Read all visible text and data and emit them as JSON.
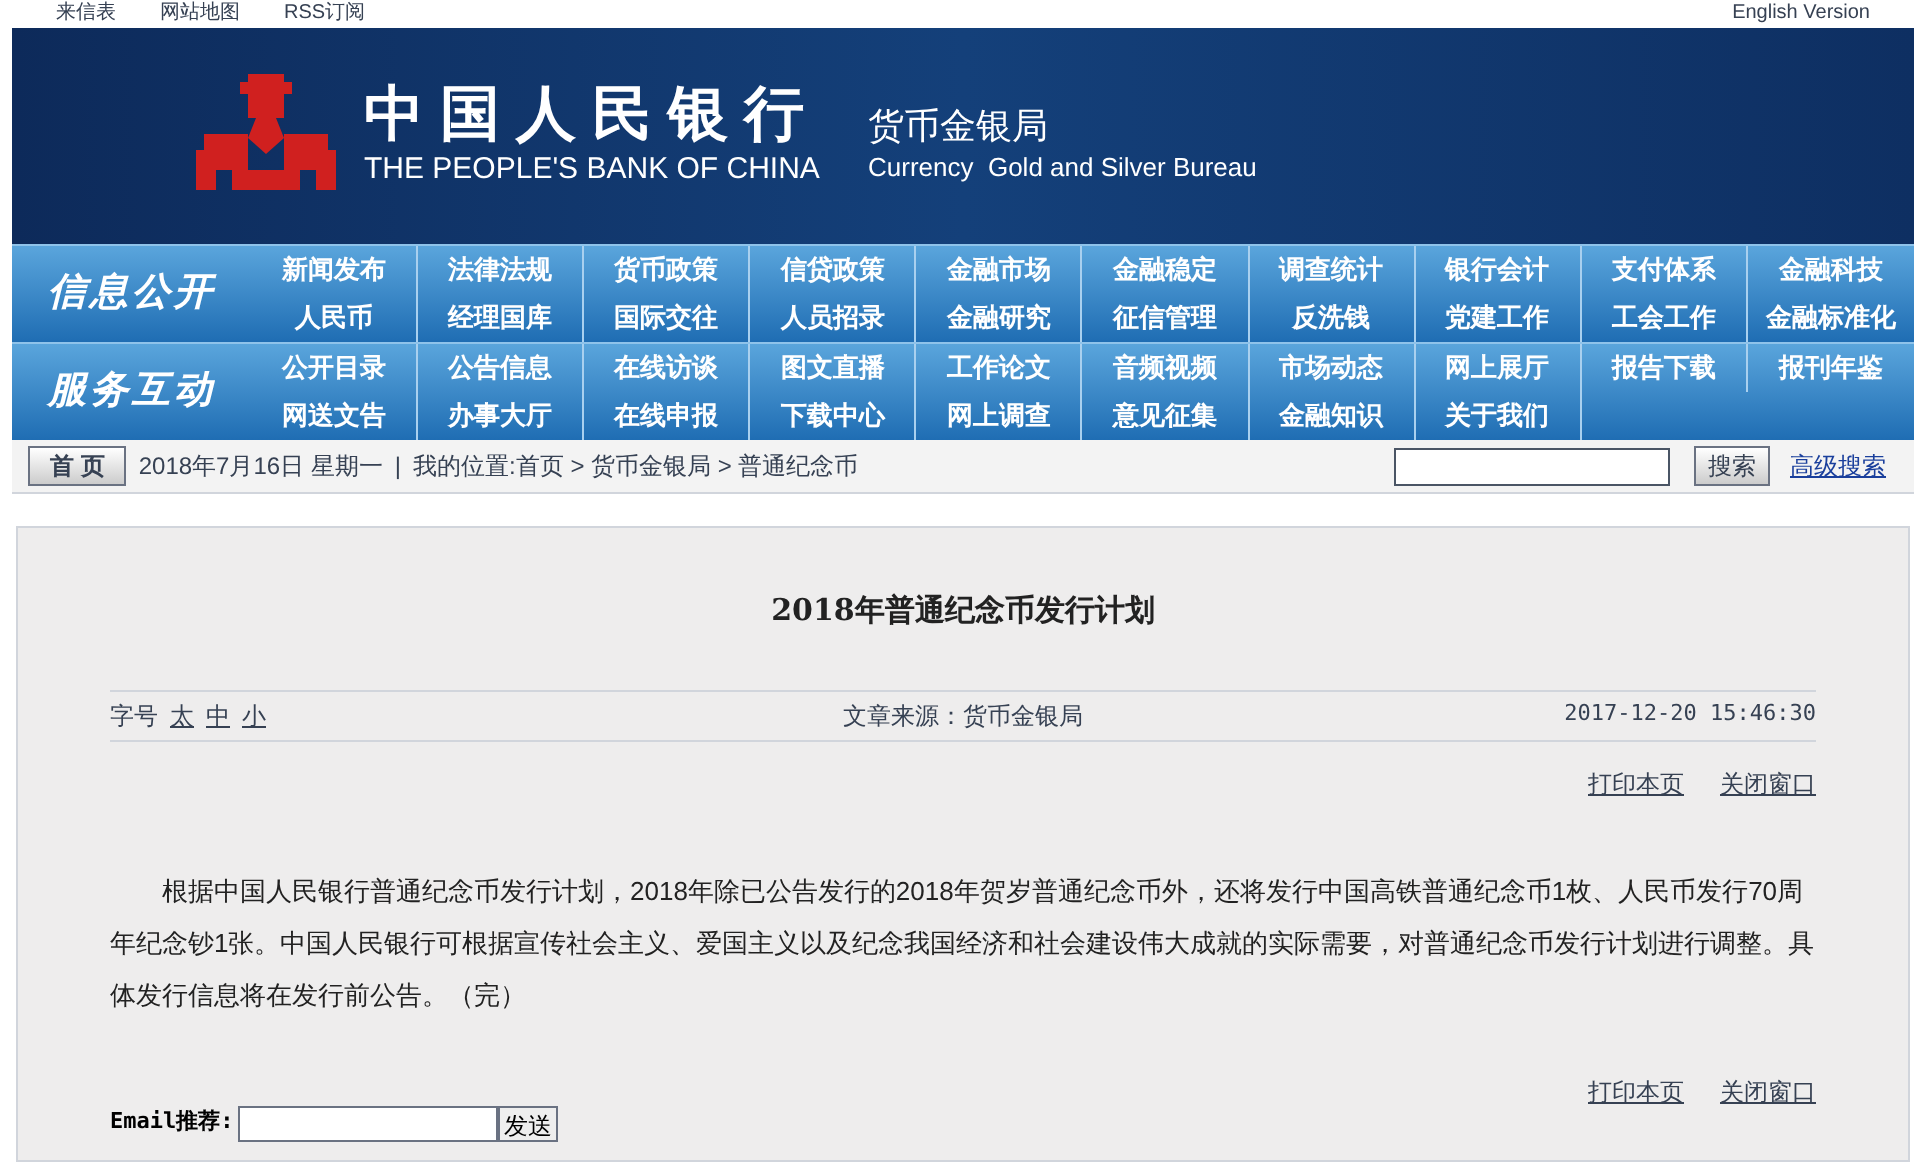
{
  "top_links": [
    {
      "label": "来信表"
    },
    {
      "label": "网站地图"
    },
    {
      "label": "RSS订阅"
    }
  ],
  "english_link": "English Version",
  "banner": {
    "title_cn": "中国人民银行",
    "title_en": "THE PEOPLE'S BANK OF CHINA",
    "bureau_cn": "货币金银局",
    "bureau_en": "Currency  Gold and Silver Bureau"
  },
  "nav_sections": [
    {
      "title": "信息公开",
      "rows": [
        [
          "新闻发布",
          "法律法规",
          "货币政策",
          "信贷政策",
          "金融市场",
          "金融稳定",
          "调查统计",
          "银行会计",
          "支付体系",
          "金融科技"
        ],
        [
          "人民币",
          "经理国库",
          "国际交往",
          "人员招录",
          "金融研究",
          "征信管理",
          "反洗钱",
          "党建工作",
          "工会工作",
          "金融标准化"
        ]
      ]
    },
    {
      "title": "服务互动",
      "rows": [
        [
          "公开目录",
          "公告信息",
          "在线访谈",
          "图文直播",
          "工作论文",
          "音频视频",
          "市场动态",
          "网上展厅",
          "报告下载",
          "报刊年鉴"
        ],
        [
          "网送文告",
          "办事大厅",
          "在线申报",
          "下载中心",
          "网上调查",
          "意见征集",
          "金融知识",
          "关于我们"
        ]
      ]
    }
  ],
  "breadcrumb": {
    "home_button": "首 页",
    "date": "2018年7月16日 星期一",
    "separator": "|",
    "location": "我的位置:首页 > 货币金银局 > 普通纪念币"
  },
  "search": {
    "button": "搜索",
    "advanced_link": "高级搜索"
  },
  "article": {
    "title": "2018年普通纪念币发行计划",
    "font_size_label": "字号",
    "font_sizes": [
      "太",
      "中",
      "小"
    ],
    "source": "文章来源：货币金银局",
    "date": "2017-12-20 15:46:30",
    "actions_top": [
      "打印本页",
      "关闭窗口"
    ],
    "body": "根据中国人民银行普通纪念币发行计划，2018年除已公告发行的2018年贺岁普通纪念币外，还将发行中国高铁普通纪念币1枚、人民币发行70周年纪念钞1张。中国人民银行可根据宣传社会主义、爱国主义以及纪念我国经济和社会建设伟大成就的实际需要，对普通纪念币发行计划进行调整。具体发行信息将在发行前公告。（完）",
    "actions_bottom": [
      "打印本页",
      "关闭窗口"
    ],
    "email_label": "Email推荐:",
    "send_button": "发送"
  }
}
